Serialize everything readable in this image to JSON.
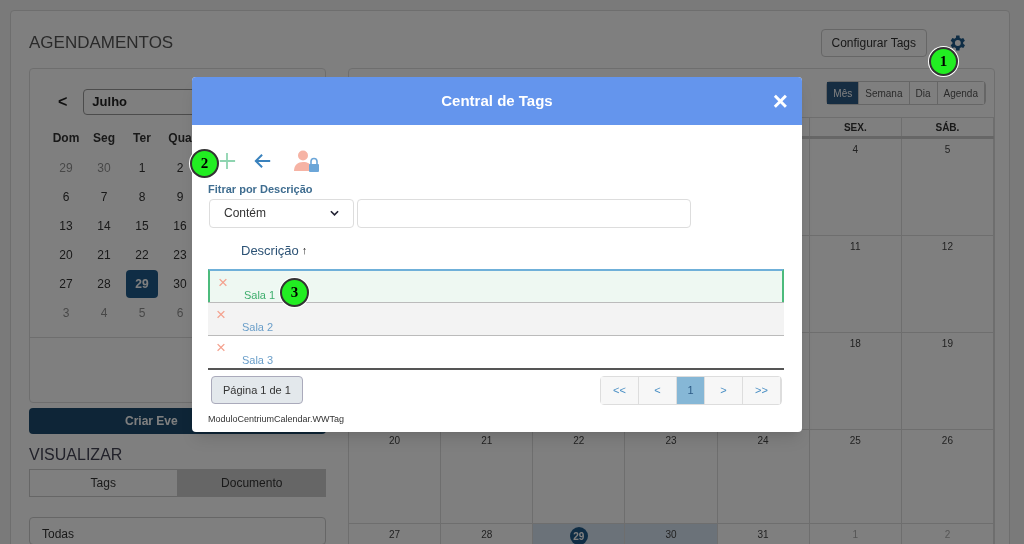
{
  "page": {
    "title": "AGENDAMENTOS",
    "config_button": "Configurar Tags"
  },
  "mini_calendar": {
    "prev": "<",
    "month": "Julho",
    "weekdays": [
      "Dom",
      "Seg",
      "Ter",
      "Qua"
    ],
    "weeks": [
      [
        {
          "day": "29",
          "muted": true,
          "selected": false
        },
        {
          "day": "30",
          "muted": true,
          "selected": false
        },
        {
          "day": "1",
          "muted": false,
          "selected": false
        },
        {
          "day": "2",
          "muted": false,
          "selected": false
        }
      ],
      [
        {
          "day": "6",
          "muted": false,
          "selected": false
        },
        {
          "day": "7",
          "muted": false,
          "selected": false
        },
        {
          "day": "8",
          "muted": false,
          "selected": false
        },
        {
          "day": "9",
          "muted": false,
          "selected": false
        }
      ],
      [
        {
          "day": "13",
          "muted": false,
          "selected": false
        },
        {
          "day": "14",
          "muted": false,
          "selected": false
        },
        {
          "day": "15",
          "muted": false,
          "selected": false
        },
        {
          "day": "16",
          "muted": false,
          "selected": false
        }
      ],
      [
        {
          "day": "20",
          "muted": false,
          "selected": false
        },
        {
          "day": "21",
          "muted": false,
          "selected": false
        },
        {
          "day": "22",
          "muted": false,
          "selected": false
        },
        {
          "day": "23",
          "muted": false,
          "selected": false
        }
      ],
      [
        {
          "day": "27",
          "muted": false,
          "selected": false
        },
        {
          "day": "28",
          "muted": false,
          "selected": false
        },
        {
          "day": "29",
          "muted": false,
          "selected": true
        },
        {
          "day": "30",
          "muted": false,
          "selected": false
        }
      ],
      [
        {
          "day": "3",
          "muted": true,
          "selected": false
        },
        {
          "day": "4",
          "muted": true,
          "selected": false
        },
        {
          "day": "5",
          "muted": true,
          "selected": false
        },
        {
          "day": "6",
          "muted": true,
          "selected": false
        }
      ]
    ]
  },
  "create_button": "Criar Eve",
  "visualizar": {
    "title": "VISUALIZAR",
    "tabs": [
      {
        "label": "Tags",
        "selected": false
      },
      {
        "label": "Documento",
        "selected": true
      }
    ],
    "select": "Todas"
  },
  "calendar": {
    "views": [
      {
        "label": "Mês",
        "selected": true
      },
      {
        "label": "Semana",
        "selected": false
      },
      {
        "label": "Dia",
        "selected": false
      },
      {
        "label": "Agenda",
        "selected": false
      }
    ],
    "headers": [
      "SEX.",
      "SÁB."
    ],
    "weeks": [
      [
        {
          "day": "4",
          "muted": false,
          "today": false,
          "highlighted": false
        },
        {
          "day": "5",
          "muted": false,
          "today": false,
          "highlighted": false
        }
      ],
      [
        {
          "day": "11",
          "muted": false,
          "today": false,
          "highlighted": false
        },
        {
          "day": "12",
          "muted": false,
          "today": false,
          "highlighted": false
        }
      ],
      [
        {
          "day": "18",
          "muted": false,
          "today": false,
          "highlighted": false
        },
        {
          "day": "19",
          "muted": false,
          "today": false,
          "highlighted": false
        }
      ],
      [
        {
          "day": "20",
          "muted": false,
          "today": false,
          "highlighted": false
        },
        {
          "day": "21",
          "muted": false,
          "today": false,
          "highlighted": false
        },
        {
          "day": "22",
          "muted": false,
          "today": false,
          "highlighted": false
        },
        {
          "day": "23",
          "muted": false,
          "today": false,
          "highlighted": false
        },
        {
          "day": "24",
          "muted": false,
          "today": false,
          "highlighted": false
        },
        {
          "day": "25",
          "muted": false,
          "today": false,
          "highlighted": false
        },
        {
          "day": "26",
          "muted": false,
          "today": false,
          "highlighted": false
        }
      ],
      [
        {
          "day": "27",
          "muted": false,
          "today": false,
          "highlighted": false
        },
        {
          "day": "28",
          "muted": false,
          "today": false,
          "highlighted": false
        },
        {
          "day": "29",
          "muted": false,
          "today": true,
          "highlighted": true
        },
        {
          "day": "30",
          "muted": false,
          "today": false,
          "highlighted": true
        },
        {
          "day": "31",
          "muted": false,
          "today": false,
          "highlighted": false
        },
        {
          "day": "1",
          "muted": true,
          "today": false,
          "highlighted": false
        },
        {
          "day": "2",
          "muted": true,
          "today": false,
          "highlighted": false
        }
      ]
    ]
  },
  "modal": {
    "title": "Central de Tags",
    "close": "×",
    "filter_label": "Fitrar por Descrição",
    "filter_operator": "Contém",
    "column": "Descrição",
    "sort": "↑",
    "rows": [
      {
        "delete": "×",
        "text": "Sala 1",
        "selected": true
      },
      {
        "delete": "×",
        "text": "Sala 2",
        "selected": false
      },
      {
        "delete": "×",
        "text": "Sala 3",
        "selected": false
      }
    ],
    "page_info": "Página 1 de 1",
    "pagination": [
      {
        "label": "<<",
        "selected": false
      },
      {
        "label": "<",
        "selected": false
      },
      {
        "label": "1",
        "selected": true
      },
      {
        "label": ">",
        "selected": false
      },
      {
        "label": ">>",
        "selected": false
      }
    ],
    "footer": "ModuloCentriumCalendar.WWTag"
  },
  "callouts": [
    {
      "text": "1"
    },
    {
      "text": "2"
    },
    {
      "text": "3"
    }
  ]
}
